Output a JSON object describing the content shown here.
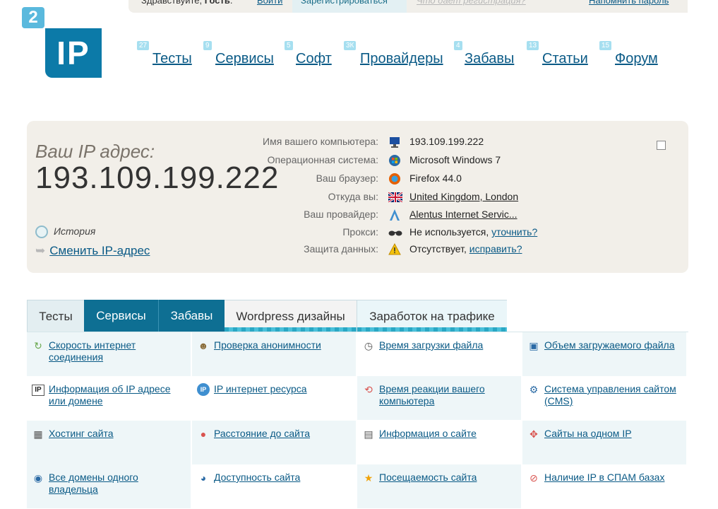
{
  "topbar": {
    "greeting": "Здравствуйте,",
    "guest": "Гость",
    "login": "Войти",
    "register": "Зарегистрироваться",
    "why_register": "Что дает регистрация?",
    "remind": "Напомнить пароль"
  },
  "logo": {
    "badge": "2",
    "text": "IP"
  },
  "nav": [
    {
      "label": "Тесты",
      "count": "27"
    },
    {
      "label": "Сервисы",
      "count": "9"
    },
    {
      "label": "Софт",
      "count": "5"
    },
    {
      "label": "Провайдеры",
      "count": "3К"
    },
    {
      "label": "Забавы",
      "count": "4"
    },
    {
      "label": "Статьи",
      "count": "13"
    },
    {
      "label": "Форум",
      "count": "15"
    }
  ],
  "ip_panel": {
    "label": "Ваш IP адрес:",
    "ip": "193.109.199.222",
    "history": "История",
    "change_ip": "Сменить IP-адрес",
    "rows": [
      {
        "label": "Имя вашего компьютера:",
        "value": "193.109.199.222",
        "icon": "computer-icon",
        "link": false
      },
      {
        "label": "Операционная система:",
        "value": "Microsoft Windows 7",
        "icon": "windows-icon",
        "link": false
      },
      {
        "label": "Ваш браузер:",
        "value": "Firefox 44.0",
        "icon": "firefox-icon",
        "link": false
      },
      {
        "label": "Откуда вы:",
        "value": "United Kingdom, London",
        "icon": "uk-flag-icon",
        "link": true
      },
      {
        "label": "Ваш провайдер:",
        "value": "Alentus Internet Servic...",
        "icon": "provider-icon",
        "link": true
      },
      {
        "label": "Прокси:",
        "value": "Не используется,",
        "link_text": "уточнить?",
        "icon": "glasses-icon"
      },
      {
        "label": "Защита данных:",
        "value": "Отсутствует,",
        "link_text": "исправить?",
        "icon": "warning-icon"
      }
    ]
  },
  "tabs": [
    "Тесты",
    "Сервисы",
    "Забавы",
    "Wordpress дизайны",
    "Заработок на трафике"
  ],
  "services": [
    {
      "label": "Скорость интернет соединения",
      "icon": "speed-icon"
    },
    {
      "label": "Проверка анонимности",
      "icon": "anonymous-icon"
    },
    {
      "label": "Время загрузки файла",
      "icon": "clock-icon"
    },
    {
      "label": "Объем загружаемого файла",
      "icon": "file-size-icon"
    },
    {
      "label": "Информация об IP адресе или домене",
      "icon": "ip-info-icon"
    },
    {
      "label": "IP интернет ресурса",
      "icon": "ip-resource-icon"
    },
    {
      "label": "Время реакции вашего компьютера",
      "icon": "reaction-icon"
    },
    {
      "label": "Система управления сайтом (CMS)",
      "icon": "cms-icon"
    },
    {
      "label": "Хостинг сайта",
      "icon": "hosting-icon"
    },
    {
      "label": "Расстояние до сайта",
      "icon": "pin-icon"
    },
    {
      "label": "Информация о сайте",
      "icon": "document-icon"
    },
    {
      "label": "Сайты на одном IP",
      "icon": "sites-icon"
    },
    {
      "label": "Все домены одного владельца",
      "icon": "domains-icon"
    },
    {
      "label": "Доступность сайта",
      "icon": "availability-icon"
    },
    {
      "label": "Посещаемость сайта",
      "icon": "star-icon"
    },
    {
      "label": "Наличие IP в СПАМ базах",
      "icon": "spam-icon"
    }
  ]
}
